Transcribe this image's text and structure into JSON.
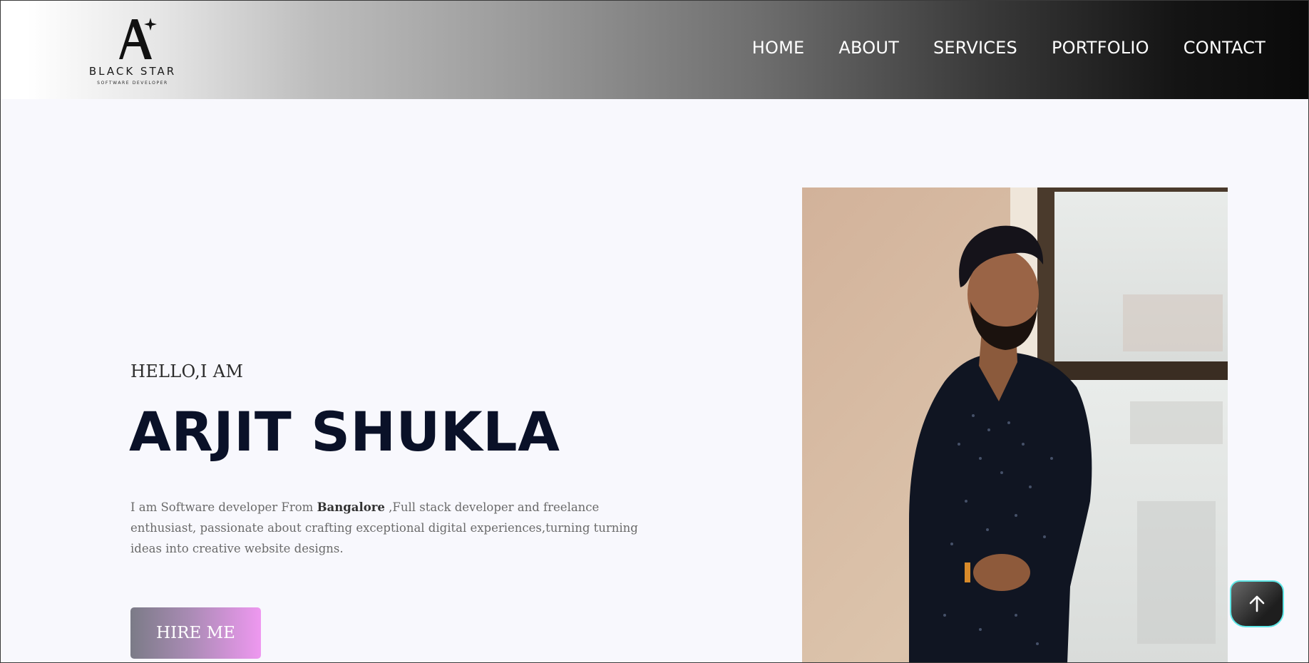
{
  "header": {
    "logo": {
      "name": "BLACK STAR",
      "tagline": "SOFTWARE DEVELOPER"
    },
    "nav": [
      "HOME",
      "ABOUT",
      "SERVICES",
      "PORTFOLIO",
      "CONTACT"
    ]
  },
  "hero": {
    "greeting": "HELLO,I AM",
    "name": "ARJIT SHUKLA",
    "intro_prefix": "I am Software developer From ",
    "intro_city": "Bangalore",
    "intro_rest": " ,Full stack developer and freelance enthusiast, passionate about crafting exceptional digital experiences,turning turning ideas into creative website designs.",
    "cta_label": "HIRE ME"
  },
  "icons": {
    "scroll_top": "arrow-up-icon",
    "logo_mark": "star-letter-a-icon"
  },
  "colors": {
    "name_text": "#0a1128",
    "cta_gradient_start": "#7b7b87",
    "cta_gradient_end": "#ee98f0",
    "scroll_border": "#5ee6e6"
  }
}
